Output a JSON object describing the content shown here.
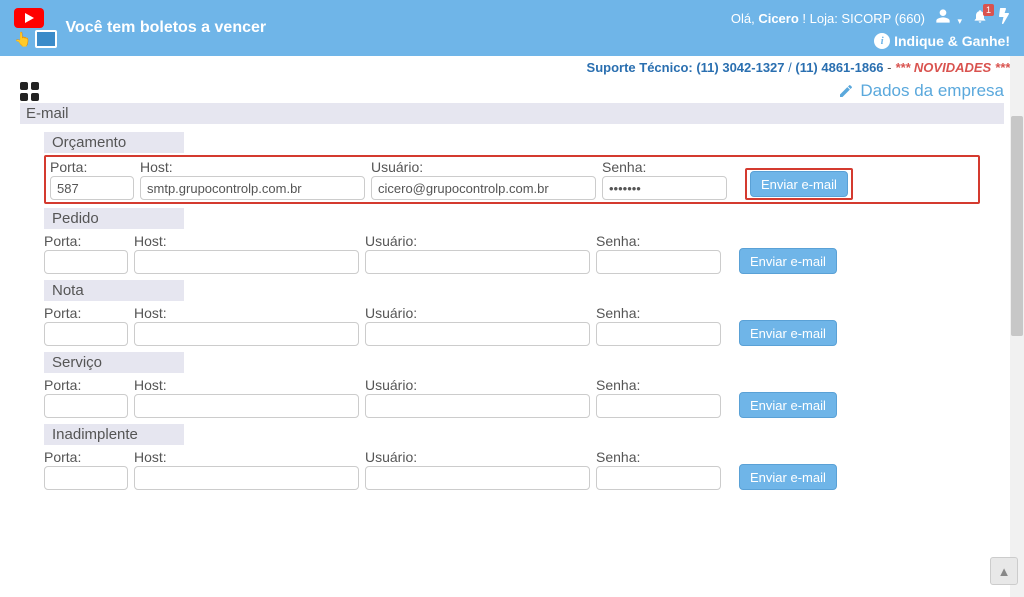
{
  "topbar": {
    "boleto_text": "Você tem boletos a vencer",
    "greeting_prefix": "Olá, ",
    "user_name": "Cicero",
    "greeting_suffix": " !  Loja: SICORP (660)",
    "indique_label": "Indique & Ganhe!",
    "notif_count": "1"
  },
  "support": {
    "label": "Suporte Técnico: ",
    "phone1": "(11) 3042-1327",
    "slash": " / ",
    "phone2": "(11) 4861-1866",
    "dash": " - ",
    "nov_stars": "*** ",
    "nov_text": "NOVIDADES",
    "nov_stars2": " ***"
  },
  "dados_link": "Dados da empresa",
  "page_heading": "E-mail",
  "labels": {
    "porta": "Porta:",
    "host": "Host:",
    "usuario": "Usuário:",
    "senha": "Senha:",
    "enviar": "Enviar e-mail"
  },
  "sections": {
    "orcamento": {
      "title": "Orçamento",
      "porta": "587",
      "host": "smtp.grupocontrolp.com.br",
      "usuario": "cicero@grupocontrolp.com.br",
      "senha": "•••••••"
    },
    "pedido": {
      "title": "Pedido",
      "porta": "",
      "host": "",
      "usuario": "",
      "senha": ""
    },
    "nota": {
      "title": "Nota",
      "porta": "",
      "host": "",
      "usuario": "",
      "senha": ""
    },
    "servico": {
      "title": "Serviço",
      "porta": "",
      "host": "",
      "usuario": "",
      "senha": ""
    },
    "inadimplente": {
      "title": "Inadimplente",
      "porta": "",
      "host": "",
      "usuario": "",
      "senha": ""
    }
  }
}
